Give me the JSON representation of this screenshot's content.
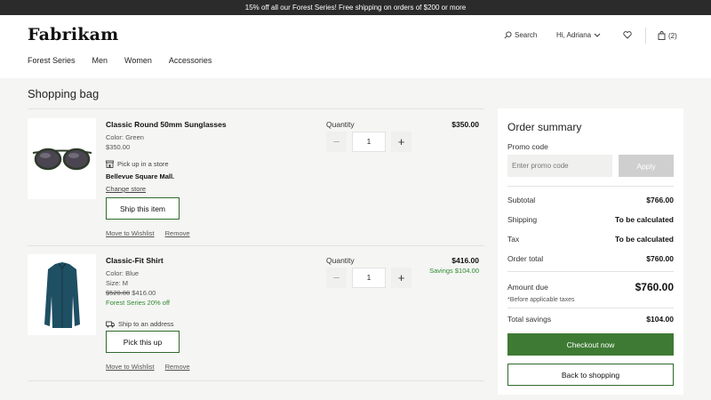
{
  "promo_bar": {
    "text": "15% off all our Forest Series! Free shipping on orders of $200 or more"
  },
  "header": {
    "logo": "Fabrikam",
    "search_label": "Search",
    "greeting": "Hi, Adriana",
    "cart_count": "(2)",
    "nav": [
      "Forest Series",
      "Men",
      "Women",
      "Accessories"
    ]
  },
  "page": {
    "title": "Shopping bag"
  },
  "items": [
    {
      "name": "Classic Round 50mm Sunglasses",
      "color": "Color: Green",
      "unit_price": "$350.00",
      "fulfillment_label": "Pick up in a store",
      "store_name": "Bellevue Square Mall.",
      "change_store": "Change store",
      "action_button": "Ship this item",
      "qty_label": "Quantity",
      "qty": "1",
      "total": "$350.00",
      "wishlist": "Move to Wishlist",
      "remove": "Remove"
    },
    {
      "name": "Classic-Fit Shirt",
      "color": "Color: Blue",
      "size": "Size: M",
      "old_price": "$520.00",
      "unit_price": "$416.00",
      "discount": "Forest Series 20% off",
      "fulfillment_label": "Ship to an address",
      "action_button": "Pick this up",
      "qty_label": "Quantity",
      "qty": "1",
      "total": "$416.00",
      "savings": "Savings $104.00",
      "wishlist": "Move to Wishlist",
      "remove": "Remove"
    }
  ],
  "summary": {
    "title": "Order summary",
    "promo_label": "Promo code",
    "promo_placeholder": "Enter promo code",
    "apply": "Apply",
    "subtotal_label": "Subtotal",
    "subtotal": "$766.00",
    "shipping_label": "Shipping",
    "shipping": "To be calculated",
    "tax_label": "Tax",
    "tax": "To be calculated",
    "order_total_label": "Order total",
    "order_total": "$760.00",
    "amount_due_label": "Amount due",
    "amount_due": "$760.00",
    "tax_note": "*Before applicable taxes",
    "savings_label": "Total savings",
    "savings": "$104.00",
    "checkout": "Checkout now",
    "back": "Back to shopping"
  },
  "colors": {
    "accent_green": "#3e7a34",
    "savings_green": "#2e8b2e",
    "promo_bar": "#2b2b2b"
  }
}
